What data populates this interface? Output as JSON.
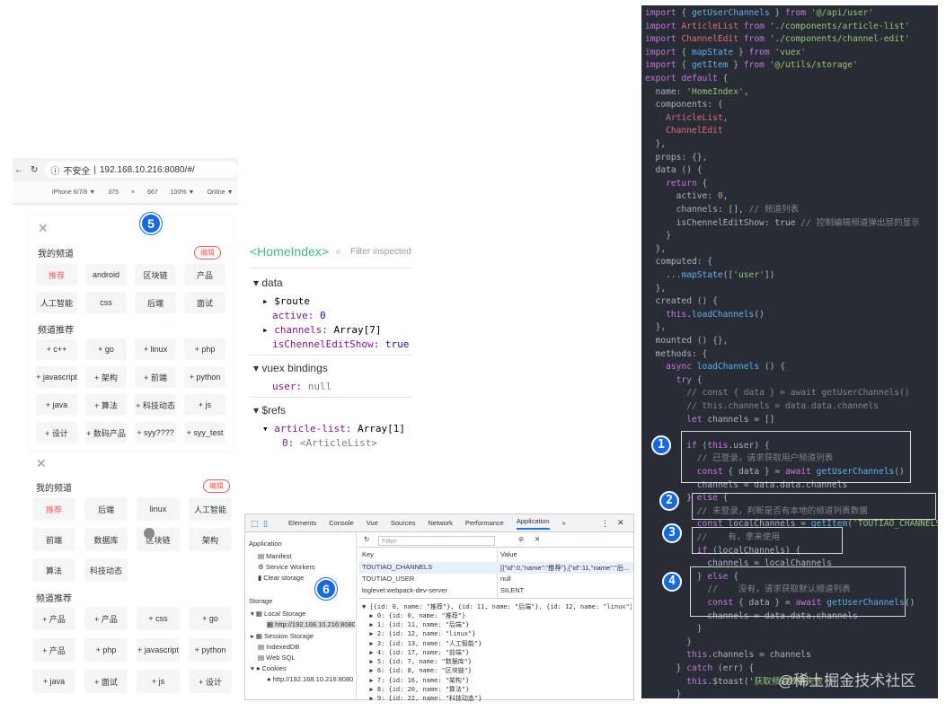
{
  "browser": {
    "security_label": "不安全",
    "url": "192.168.10.216:8080/#/",
    "device": "iPhone 6/7/8 ▼",
    "width": "375",
    "x": "×",
    "height": "667",
    "zoom": "100% ▼",
    "network": "Online ▼"
  },
  "panel1": {
    "my_channels_title": "我的频道",
    "edit_label": "编辑",
    "my_channels": [
      "推荐",
      "android",
      "区块链",
      "产品",
      "人工智能",
      "css",
      "后端",
      "面试"
    ],
    "recommend_title": "频道推荐",
    "recommended": [
      "+ c++",
      "+ go",
      "+ linux",
      "+ php",
      "+ javascript",
      "+ 架构",
      "+ 前端",
      "+ python",
      "+ java",
      "+ 算法",
      "+ 科技动态",
      "+ js",
      "+ 设计",
      "+ 数码产品",
      "+ syy????",
      "+ syy_test"
    ]
  },
  "panel2": {
    "my_channels_title": "我的频道",
    "edit_label": "编辑",
    "my_channels": [
      "推荐",
      "后端",
      "linux",
      "人工智能",
      "前端",
      "数据库",
      "区块链",
      "架构",
      "算法",
      "科技动态"
    ],
    "recommend_title": "频道推荐",
    "recommended": [
      "+ 产品",
      "+ 产品",
      "+ css",
      "+ go",
      "+ 产品",
      "+ php",
      "+ javascript",
      "+ python",
      "+ java",
      "+ 面试",
      "+ js",
      "+ 设计"
    ]
  },
  "badges": {
    "five": "5",
    "six": "6",
    "one": "1",
    "two": "2",
    "three": "3",
    "four": "4"
  },
  "vue_devtools": {
    "component": "<HomeIndex>",
    "filter_placeholder": "Filter inspected",
    "data_section": "data",
    "route": "$route",
    "active_key": "active:",
    "active_val": "0",
    "channels_key": "channels:",
    "channels_val": "Array[7]",
    "edit_key": "isChennelEditShow:",
    "edit_val": "true",
    "vuex_section": "vuex bindings",
    "user_key": "user:",
    "user_val": "null",
    "refs_section": "$refs",
    "article_key": "article-list:",
    "article_val": "Array[1]",
    "ref0_key": "0:",
    "ref0_val": "<ArticleList>"
  },
  "chrome_devtools": {
    "tabs": [
      "Elements",
      "Console",
      "Vue",
      "Sources",
      "Network",
      "Performance",
      "Application",
      "»"
    ],
    "side": {
      "application": "Application",
      "manifest": "Manifest",
      "service_workers": "Service Workers",
      "clear_storage": "Clear storage",
      "storage": "Storage",
      "local_storage": "Local Storage",
      "local_url": "http://192.168.10.216:8080",
      "session_storage": "Session Storage",
      "indexeddb": "IndexedDB",
      "websql": "Web SQL",
      "cookies": "Cookies",
      "cookie_url": "http://192.168.10.216:8080"
    },
    "filter_placeholder": "Filter",
    "col_key": "Key",
    "col_value": "Value",
    "rows": [
      {
        "key": "TOUTIAO_CHANNELS",
        "value": "[{\"id\":0,\"name\":\"推荐\"},{\"id\":11,\"name\":\"后..."
      },
      {
        "key": "TOUTIAO_USER",
        "value": "null"
      },
      {
        "key": "loglevel:webpack-dev-server",
        "value": "SILENT"
      }
    ],
    "preview": [
      "▼ [{id: 0, name: \"推荐\"}, {id: 11, name: \"后端\"}, {id: 12, name: \"linux\"}",
      "  ▶ 0: {id: 0, name: \"推荐\"}",
      "  ▶ 1: {id: 11, name: \"后端\"}",
      "  ▶ 2: {id: 12, name: \"linux\"}",
      "  ▶ 3: {id: 13, name: \"人工智能\"}",
      "  ▶ 4: {id: 17, name: \"前端\"}",
      "  ▶ 5: {id: 7, name: \"数据库\"}",
      "  ▶ 6: {id: 8, name: \"区块链\"}",
      "  ▶ 7: {id: 16, name: \"架构\"}",
      "  ▶ 8: {id: 20, name: \"算法\"}",
      "  ▶ 9: {id: 22, name: \"科技动态\"}"
    ]
  },
  "code": {
    "lines": [
      "import { getUserChannels } from '@/api/user'",
      "import ArticleList from './components/article-list'",
      "import ChannelEdit from './components/channel-edit'",
      "import { mapState } from 'vuex'",
      "import { getItem } from '@/utils/storage'",
      "export default {",
      "  name: 'HomeIndex',",
      "  components: {",
      "    ArticleList,",
      "    ChannelEdit",
      "  },",
      "  props: {},",
      "  data () {",
      "    return {",
      "      active: 0,",
      "      channels: [], // 频道列表",
      "      isChennelEditShow: true // 控制编辑频道弹出层的显示",
      "    }",
      "  },",
      "  computed: {",
      "    ...mapState(['user'])",
      "  },",
      "  created () {",
      "    this.loadChannels()",
      "  },",
      "  mounted () {},",
      "  methods: {",
      "    async loadChannels () {",
      "      try {",
      "        // const { data } = await getUserChannels()",
      "        // this.channels = data.data.channels",
      "        let channels = []",
      "",
      "        if (this.user) {",
      "          // 已登录，请求获取用户频道列表",
      "          const { data } = await getUserChannels()",
      "          channels = data.data.channels",
      "        } else {",
      "          // 未登录，判断是否有本地的频道列表数据",
      "          const localChannels = getItem('TOUTIAO_CHANNELS')",
      "          //    有，拿来使用",
      "          if (localChannels) {",
      "            channels = localChannels",
      "          } else {",
      "            //    没有，请求获取默认频道列表",
      "            const { data } = await getUserChannels()",
      "            channels = data.data.channels",
      "          }",
      "        }",
      "        this.channels = channels",
      "      } catch (err) {",
      "        this.$toast('获取频道数据失败')",
      "      }",
      "    },"
    ]
  },
  "watermark": "@稀土掘金技术社区"
}
